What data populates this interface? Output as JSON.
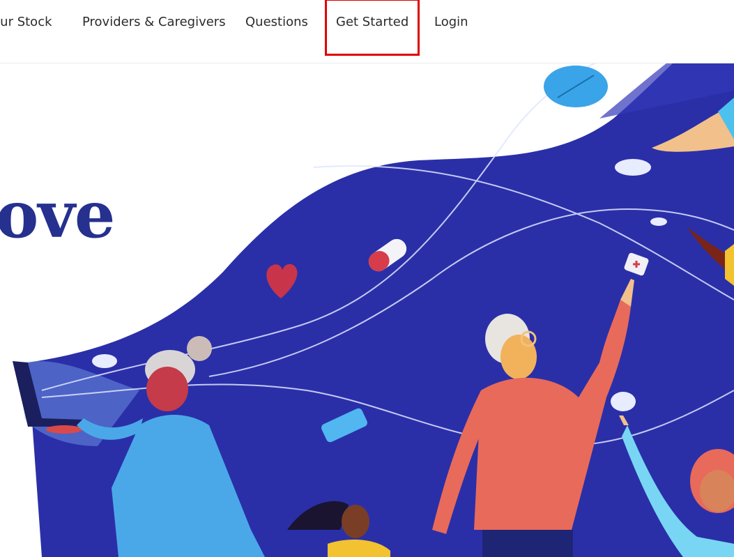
{
  "nav": {
    "items": [
      {
        "label": "Our Stock"
      },
      {
        "label": "Providers & Caregivers"
      },
      {
        "label": "Questions"
      },
      {
        "label": "Get Started",
        "highlighted": true
      },
      {
        "label": "Login"
      }
    ]
  },
  "hero": {
    "headline_fragment": "ove"
  },
  "colors": {
    "brand_navy": "#25308f",
    "wave_blue": "#2a2fa8",
    "highlight_box": "#e00000"
  }
}
